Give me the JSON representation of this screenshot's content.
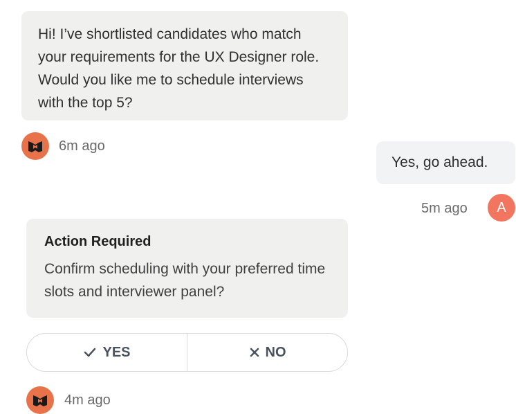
{
  "messages": [
    {
      "sender": "assistant",
      "text": "Hi! I’ve shortlisted candidates who match your requirements for the UX Designer role. Would you like me to schedule interviews with the top 5?",
      "time": "6m ago",
      "avatar_icon": "bot-logo-icon"
    },
    {
      "sender": "user",
      "text": "Yes, go ahead.",
      "time": "5m ago",
      "avatar_initial": "A"
    }
  ],
  "action_card": {
    "title": "Action Required",
    "text": "Confirm scheduling with your preferred time slots and interviewer panel?",
    "yes_label": "YES",
    "no_label": "NO",
    "time": "4m ago"
  },
  "colors": {
    "bot_avatar": "#e8734a",
    "user_avatar": "#f2765f",
    "bubble": "#f0f0ef"
  }
}
